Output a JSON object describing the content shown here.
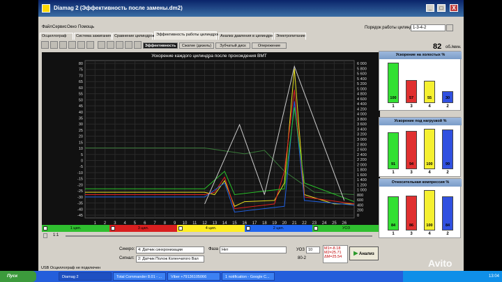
{
  "window": {
    "title": "Diamag 2 (Эффективность после замены.dm2)",
    "min": "_",
    "max": "□",
    "close": "X"
  },
  "menu": [
    "Файл",
    "Сервис",
    "Окно",
    "Помощь"
  ],
  "order": {
    "label": "Порядок работы цилиндров",
    "value": "1-3-4-2"
  },
  "tabs": [
    "Осциллограф",
    "Система зажигания",
    "Сравнение цилиндров",
    "Эффективность работы цилиндров",
    "Анализ давления в цилиндре",
    "Электропитание"
  ],
  "subtabs": [
    "Эффективность",
    "Сжатие (дизель)",
    "Зубчатый диск",
    "Опережение"
  ],
  "speed": {
    "value": "82",
    "unit": "об./мин."
  },
  "chart_data": {
    "type": "line",
    "title": "Ускорение каждого цилиндра после прохождения ВМТ",
    "x_ticks": [
      "1",
      "2",
      "3",
      "4",
      "5",
      "6",
      "7",
      "8",
      "9",
      "10",
      "11",
      "12",
      "13",
      "14",
      "15",
      "16",
      "17",
      "18",
      "19",
      "20",
      "21",
      "22",
      "23",
      "24",
      "25",
      "26"
    ],
    "y_left_ticks": [
      "80",
      "75",
      "70",
      "65",
      "60",
      "55",
      "50",
      "45",
      "40",
      "35",
      "30",
      "25",
      "20",
      "15",
      "10",
      "5",
      "0",
      "-5",
      "-10",
      "-15",
      "-20",
      "-25",
      "-30",
      "-35",
      "-40",
      "-45"
    ],
    "y_right_ticks": [
      "6 000",
      "5 800",
      "5 600",
      "5 400",
      "5 200",
      "5 000",
      "4 800",
      "4 600",
      "4 400",
      "4 200",
      "4 000",
      "3 800",
      "3 600",
      "3 400",
      "3 200",
      "3 000",
      "2 800",
      "2 600",
      "2 400",
      "2 200",
      "2 000",
      "1 800",
      "1 600",
      "1 400",
      "1 200",
      "1 000",
      "800",
      "600",
      "400",
      "200",
      "0"
    ],
    "xlim": [
      0,
      27
    ],
    "ylim": [
      -50,
      85
    ],
    "series": [
      {
        "name": "1 цил.",
        "color": "#29c229"
      },
      {
        "name": "3 цил.",
        "color": "#e02020"
      },
      {
        "name": "4 цил.",
        "color": "#e8e020"
      },
      {
        "name": "2 цил.",
        "color": "#2060e0"
      }
    ]
  },
  "legend": [
    {
      "label": "1 цил.",
      "color": "#2fbf2f"
    },
    {
      "label": "3 цил.",
      "color": "#d91f1f"
    },
    {
      "label": "4 цил.",
      "color": "#ffee22"
    },
    {
      "label": "2 цил.",
      "color": "#2266ee"
    },
    {
      "label": "УОЗ",
      "color": "#2fbf2f"
    }
  ],
  "zoom": {
    "value": "1:1"
  },
  "controls": {
    "sync_label": "Синхро:",
    "sync_value": "4: Датчик синхронизации",
    "signal_label": "Сигнал:",
    "signal_value": "2: Датчик Полож Коленчатого Вал",
    "phase_label": "Фаза",
    "phase_value": "Нет",
    "uoz_label": "УОЗ",
    "uoz_value": "10",
    "uoz_sub": "80-2",
    "m1": "M1=-8.18",
    "m2": "M2=25.71",
    "dm": "ΔM=25.54",
    "analyze": "Анализ"
  },
  "gauges": [
    {
      "title": "Ускорение на холостых %",
      "bars": [
        {
          "cyl": "1",
          "value": 100,
          "color": "#33e033"
        },
        {
          "cyl": "3",
          "value": 57,
          "color": "#e03030"
        },
        {
          "cyl": "4",
          "value": 55,
          "color": "#f5f030"
        },
        {
          "cyl": "2",
          "value": 30,
          "color": "#3050e0"
        }
      ]
    },
    {
      "title": "Ускорение под нагрузкой %",
      "bars": [
        {
          "cyl": "1",
          "value": 91,
          "color": "#33e033"
        },
        {
          "cyl": "3",
          "value": 94,
          "color": "#e03030"
        },
        {
          "cyl": "4",
          "value": 100,
          "color": "#f5f030"
        },
        {
          "cyl": "2",
          "value": 99,
          "color": "#3050e0"
        }
      ]
    },
    {
      "title": "Относительная компрессия %",
      "bars": [
        {
          "cyl": "1",
          "value": 84,
          "color": "#33e033"
        },
        {
          "cyl": "3",
          "value": 86,
          "color": "#e03030"
        },
        {
          "cyl": "4",
          "value": 100,
          "color": "#f5f030"
        },
        {
          "cyl": "2",
          "value": 84,
          "color": "#3050e0"
        }
      ]
    }
  ],
  "status": "USB Осциллограф не подключен",
  "taskbar": {
    "start": "Пуск",
    "tasks": [
      "Diamag 2",
      "Total Commander 8.01 - ...",
      "Viber +79136105066",
      "1 notification - Google C..."
    ],
    "clock": "13:04"
  },
  "watermark": "Avito"
}
